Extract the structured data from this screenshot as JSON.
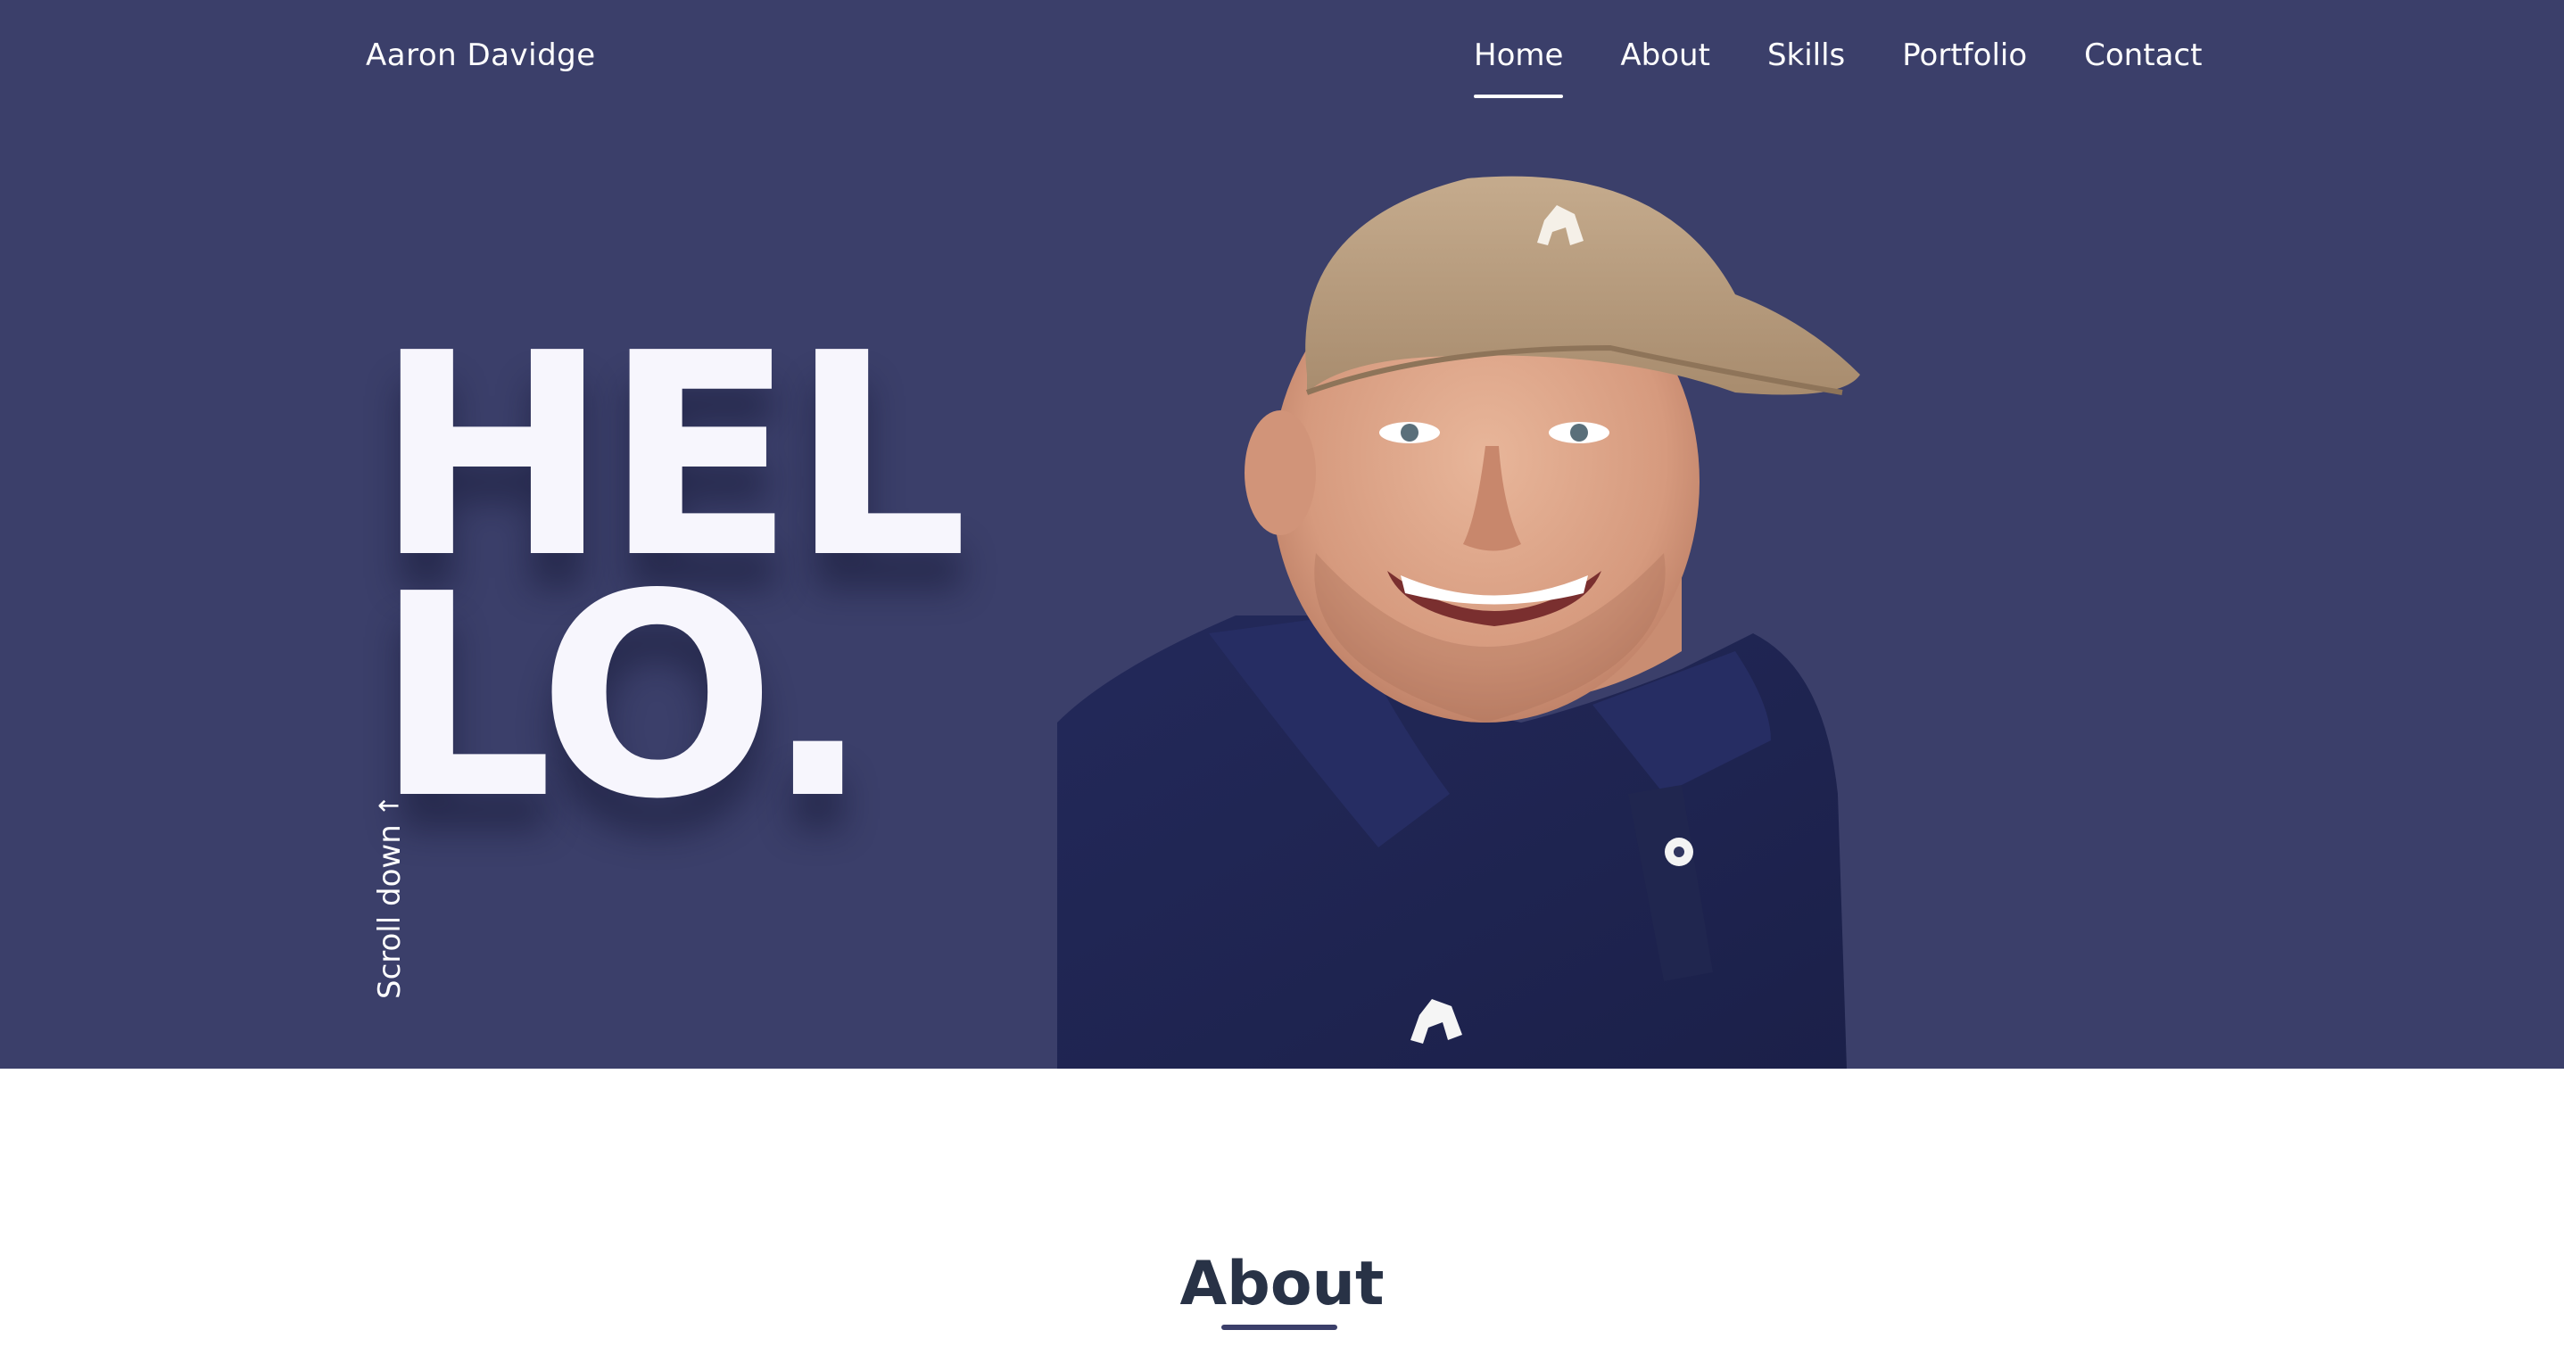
{
  "header": {
    "brand": "Aaron Davidge",
    "nav": [
      {
        "label": "Home",
        "active": true
      },
      {
        "label": "About",
        "active": false
      },
      {
        "label": "Skills",
        "active": false
      },
      {
        "label": "Portfolio",
        "active": false
      },
      {
        "label": "Contact",
        "active": false
      }
    ]
  },
  "hero": {
    "greeting_line1": "HEL",
    "greeting_line2": "LO.",
    "scroll_label": "Scroll down",
    "scroll_icon": "arrow-down-icon",
    "background_color": "#3b3f6a",
    "portrait": "profile-photo"
  },
  "about": {
    "title": "About"
  }
}
